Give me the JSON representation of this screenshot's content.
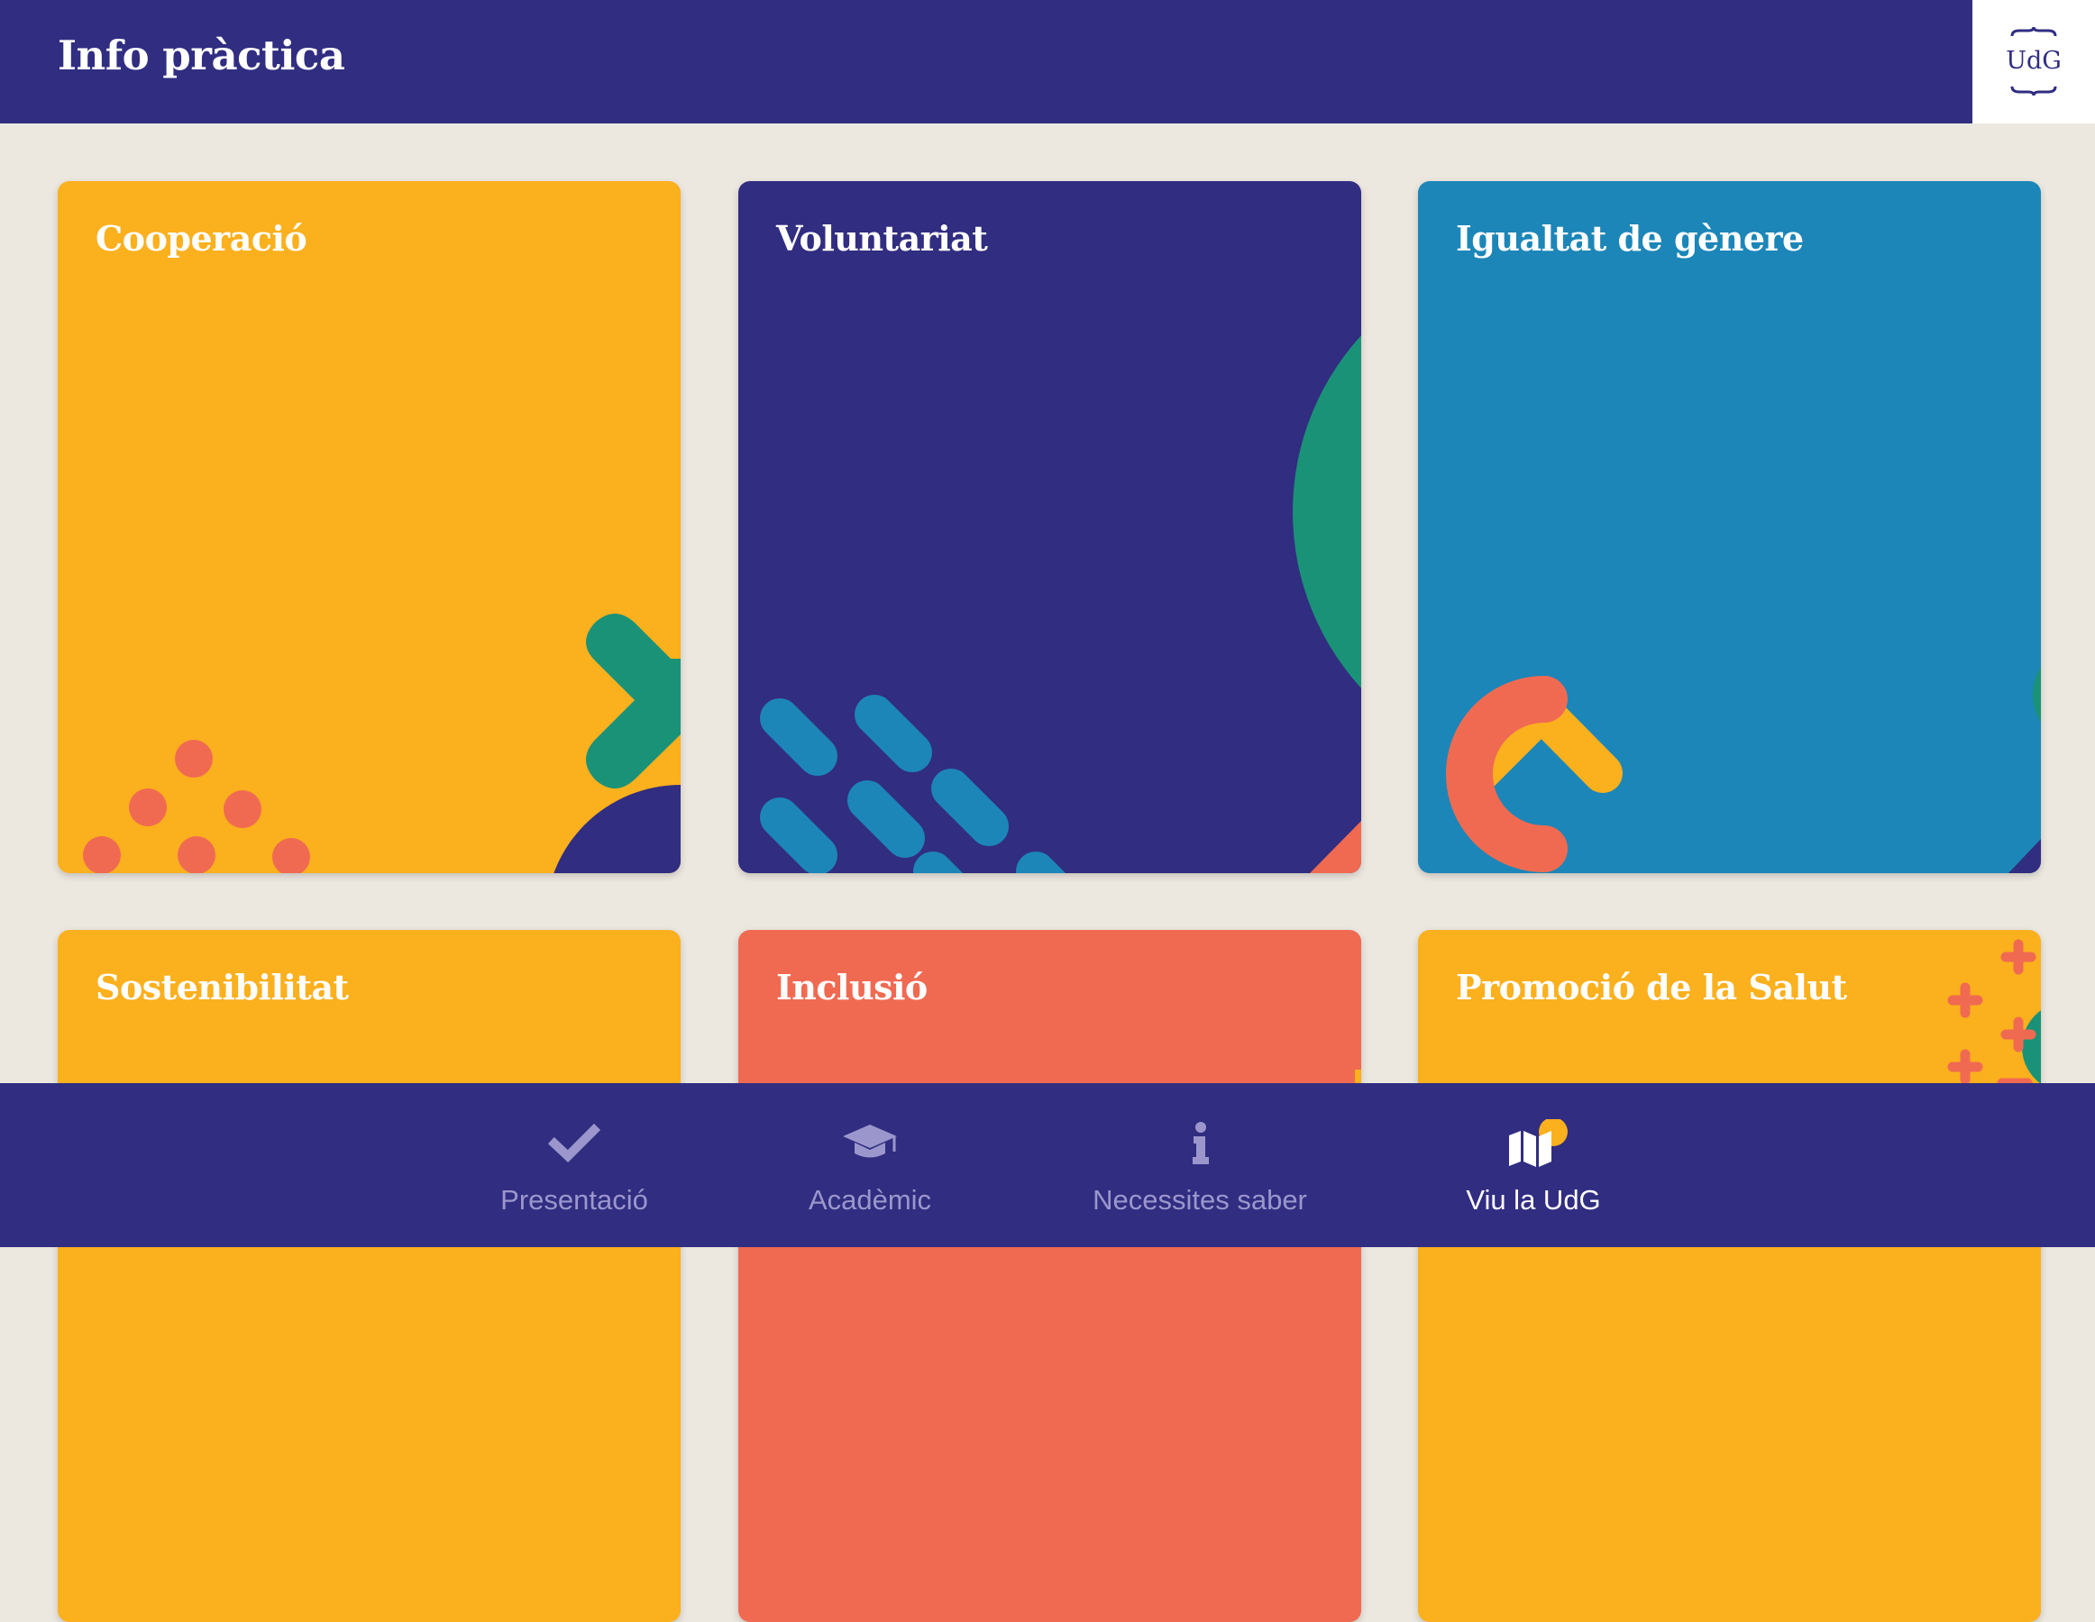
{
  "header": {
    "title": "Info pràctica",
    "logo_text": "UdG"
  },
  "cards": [
    {
      "title": "Cooperació",
      "color": "#FBB01E"
    },
    {
      "title": "Voluntariat",
      "color": "#312D81"
    },
    {
      "title": "Igualtat de gènere",
      "color": "#1C86B8"
    },
    {
      "title": "Sostenibilitat",
      "color": "#FBB01E"
    },
    {
      "title": "Inclusió",
      "color": "#F06A52"
    },
    {
      "title": "Promoció de la Salut",
      "color": "#FBB01E"
    }
  ],
  "nav": {
    "items": [
      {
        "label": "Presentació",
        "icon": "check-icon"
      },
      {
        "label": "Acadèmic",
        "icon": "graduation-cap-icon"
      },
      {
        "label": "Necessites saber",
        "icon": "info-icon"
      },
      {
        "label": "Viu la UdG",
        "icon": "map-icon",
        "active": true
      }
    ]
  },
  "colors": {
    "primary": "#312D81",
    "yellow": "#FBB01E",
    "blue": "#1C86B8",
    "coral": "#F06A52",
    "green": "#1A9277",
    "background": "#ECE8E0"
  }
}
